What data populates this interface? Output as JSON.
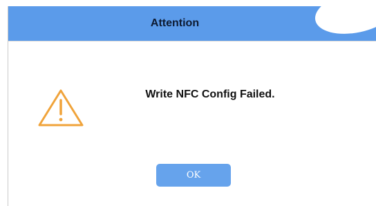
{
  "dialog": {
    "title": "Attention",
    "message": "Write NFC Config Failed.",
    "ok_label": "OK",
    "icon": "warning-triangle-icon"
  },
  "colors": {
    "title_bar": "#5b9bea",
    "button": "#66a3ec",
    "warning": "#f0a33a"
  }
}
